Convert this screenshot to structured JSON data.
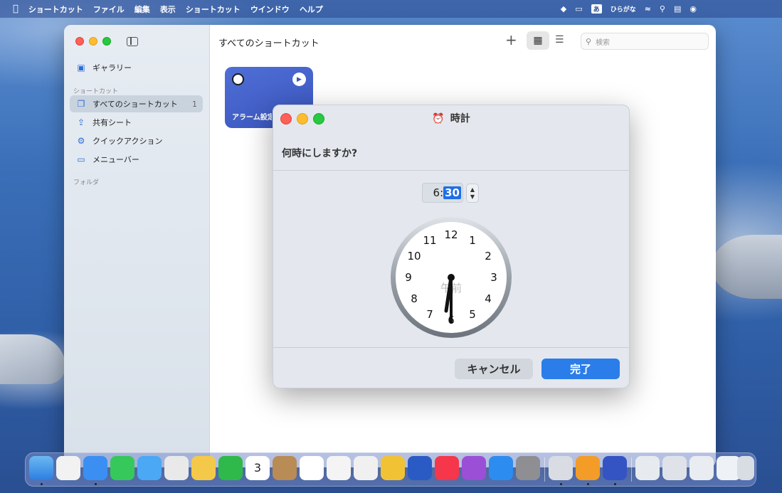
{
  "menubar": {
    "apple_icon": "apple-icon",
    "items": [
      "ショートカット",
      "ファイル",
      "編集",
      "表示",
      "ショートカット",
      "ウインドウ",
      "ヘルプ"
    ],
    "ime_badge": "あ",
    "ime_label": "ひらがな"
  },
  "sidebar": {
    "gallery": "ギャラリー",
    "section_shortcuts": "ショートカット",
    "items": [
      {
        "label": "すべてのショートカット",
        "count": "1",
        "icon": "square-stack-icon"
      },
      {
        "label": "共有シート",
        "icon": "share-icon"
      },
      {
        "label": "クイックアクション",
        "icon": "gear-icon"
      },
      {
        "label": "メニューバー",
        "icon": "menubar-icon"
      }
    ],
    "section_folders": "フォルダ"
  },
  "main": {
    "title": "すべてのショートカット",
    "search_placeholder": "検索",
    "tile": {
      "name": "アラーム設定",
      "color": "#4f6fd6"
    }
  },
  "dialog": {
    "title": "時計",
    "question": "何時にしますか?",
    "time_hour": "6",
    "time_sep": ":",
    "time_minute": "30",
    "clock_numbers": [
      "12",
      "1",
      "2",
      "3",
      "4",
      "5",
      "6",
      "7",
      "8",
      "9",
      "10",
      "11"
    ],
    "period_label": "午前",
    "cancel": "キャンセル",
    "done": "完了",
    "accent_color": "#2b7de9"
  },
  "dock": {
    "calendar_day": "3"
  }
}
